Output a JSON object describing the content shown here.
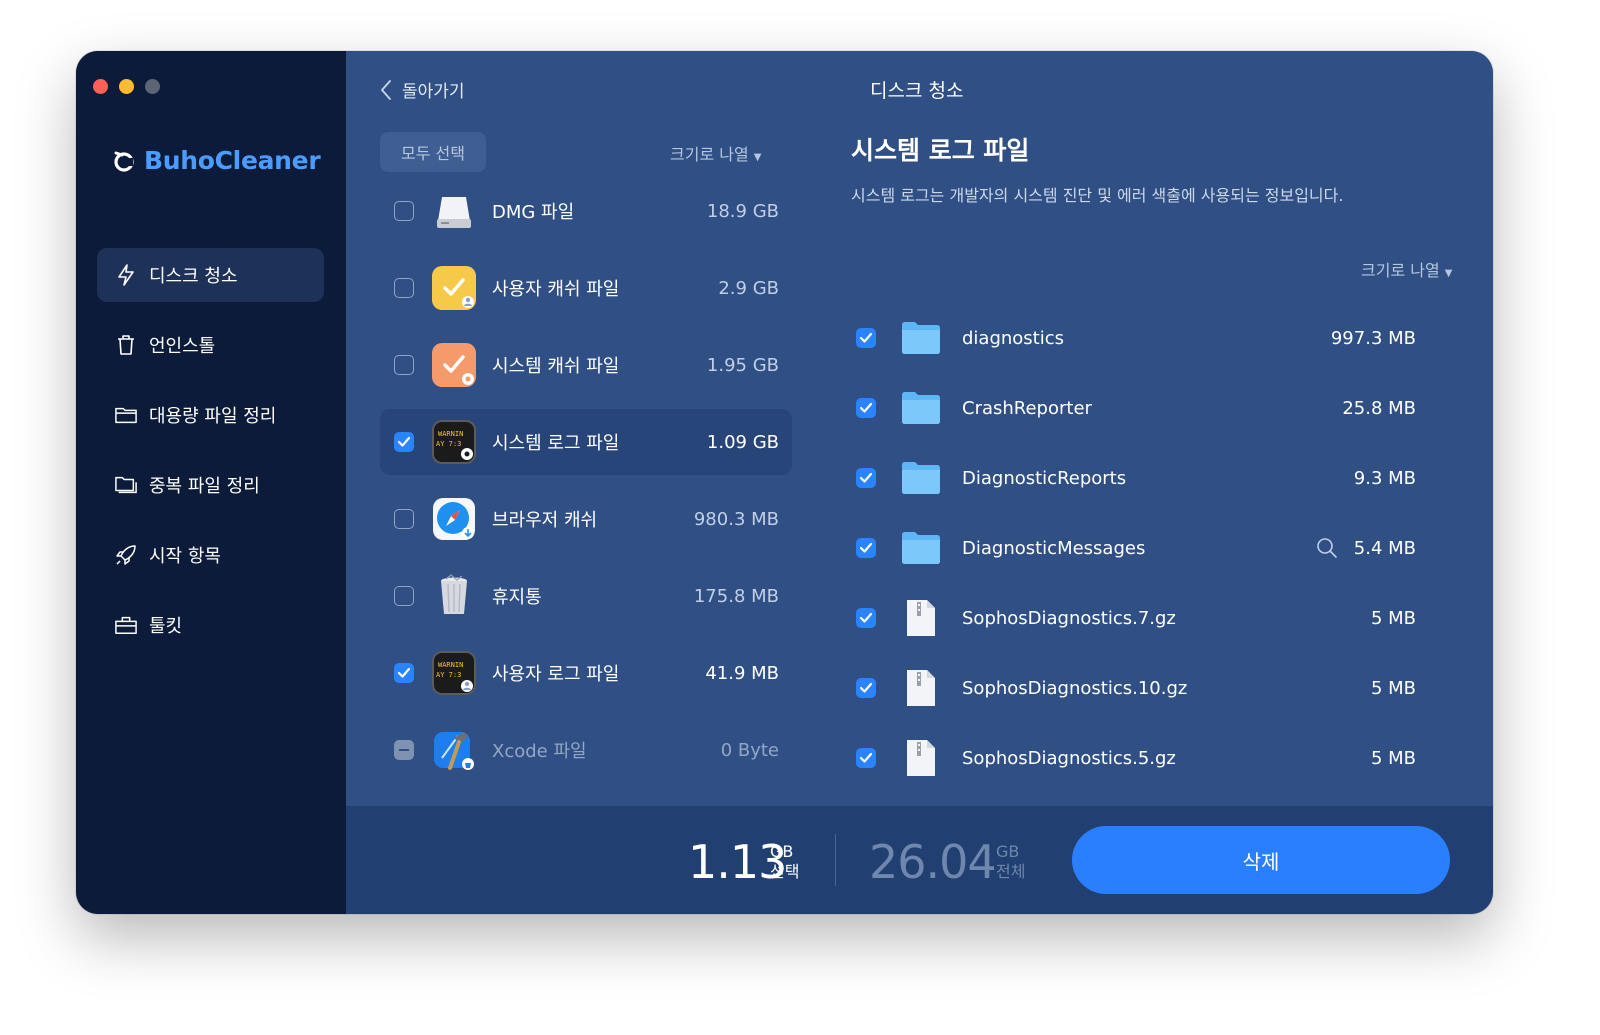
{
  "app": {
    "name": "BuhoCleaner",
    "brand_color": "#4a9cff"
  },
  "sidebar": {
    "items": [
      {
        "label": "디스크 청소",
        "icon": "lightning-icon",
        "active": true
      },
      {
        "label": "언인스톨",
        "icon": "trash-icon"
      },
      {
        "label": "대용량 파일 정리",
        "icon": "folder-icon"
      },
      {
        "label": "중복 파일 정리",
        "icon": "duplicate-folder-icon"
      },
      {
        "label": "시작 항목",
        "icon": "rocket-icon"
      },
      {
        "label": "툴킷",
        "icon": "toolbox-icon"
      }
    ]
  },
  "header": {
    "back_label": "돌아가기",
    "title": "디스크 청소"
  },
  "categories": {
    "select_all_label": "모두 선택",
    "sort_label": "크기로 나열",
    "items": [
      {
        "name": "DMG 파일",
        "size": "18.9 GB",
        "checked": false,
        "icon": "disk-image-icon"
      },
      {
        "name": "사용자 캐쉬 파일",
        "size": "2.9 GB",
        "checked": false,
        "icon": "user-cache-icon"
      },
      {
        "name": "시스템 캐쉬 파일",
        "size": "1.95 GB",
        "checked": false,
        "icon": "system-cache-icon"
      },
      {
        "name": "시스템 로그 파일",
        "size": "1.09 GB",
        "checked": true,
        "selected": true,
        "icon": "system-log-icon",
        "icon_text": [
          "WARNIN",
          "AY 7:3"
        ]
      },
      {
        "name": "브라우저 캐쉬",
        "size": "980.3 MB",
        "checked": false,
        "icon": "safari-icon"
      },
      {
        "name": "휴지통",
        "size": "175.8 MB",
        "checked": false,
        "icon": "trash-bin-icon"
      },
      {
        "name": "사용자 로그 파일",
        "size": "41.9 MB",
        "checked": true,
        "icon": "user-log-icon",
        "icon_text": [
          "WARNIN",
          "AY 7:3"
        ]
      },
      {
        "name": "Xcode 파일",
        "size": "0 Byte",
        "checked": "mixed",
        "disabled": true,
        "icon": "xcode-icon"
      }
    ]
  },
  "detail": {
    "title": "시스템 로그 파일",
    "description": "시스템 로그는 개발자의 시스템 진단 및 에러 색출에 사용되는 정보입니다.",
    "sort_label": "크기로 나열",
    "files": [
      {
        "name": "diagnostics",
        "size": "997.3 MB",
        "type": "folder",
        "checked": true
      },
      {
        "name": "CrashReporter",
        "size": "25.8 MB",
        "type": "folder",
        "checked": true
      },
      {
        "name": "DiagnosticReports",
        "size": "9.3 MB",
        "type": "folder",
        "checked": true
      },
      {
        "name": "DiagnosticMessages",
        "size": "5.4 MB",
        "type": "folder",
        "checked": true,
        "search_icon": true
      },
      {
        "name": "SophosDiagnostics.7.gz",
        "size": "5 MB",
        "type": "archive",
        "checked": true
      },
      {
        "name": "SophosDiagnostics.10.gz",
        "size": "5 MB",
        "type": "archive",
        "checked": true
      },
      {
        "name": "SophosDiagnostics.5.gz",
        "size": "5 MB",
        "type": "archive",
        "checked": true
      }
    ]
  },
  "footer": {
    "selected_value": "1.13",
    "selected_unit": "GB",
    "selected_label": "선택",
    "total_value": "26.04",
    "total_unit": "GB",
    "total_label": "전체",
    "delete_label": "삭제"
  }
}
